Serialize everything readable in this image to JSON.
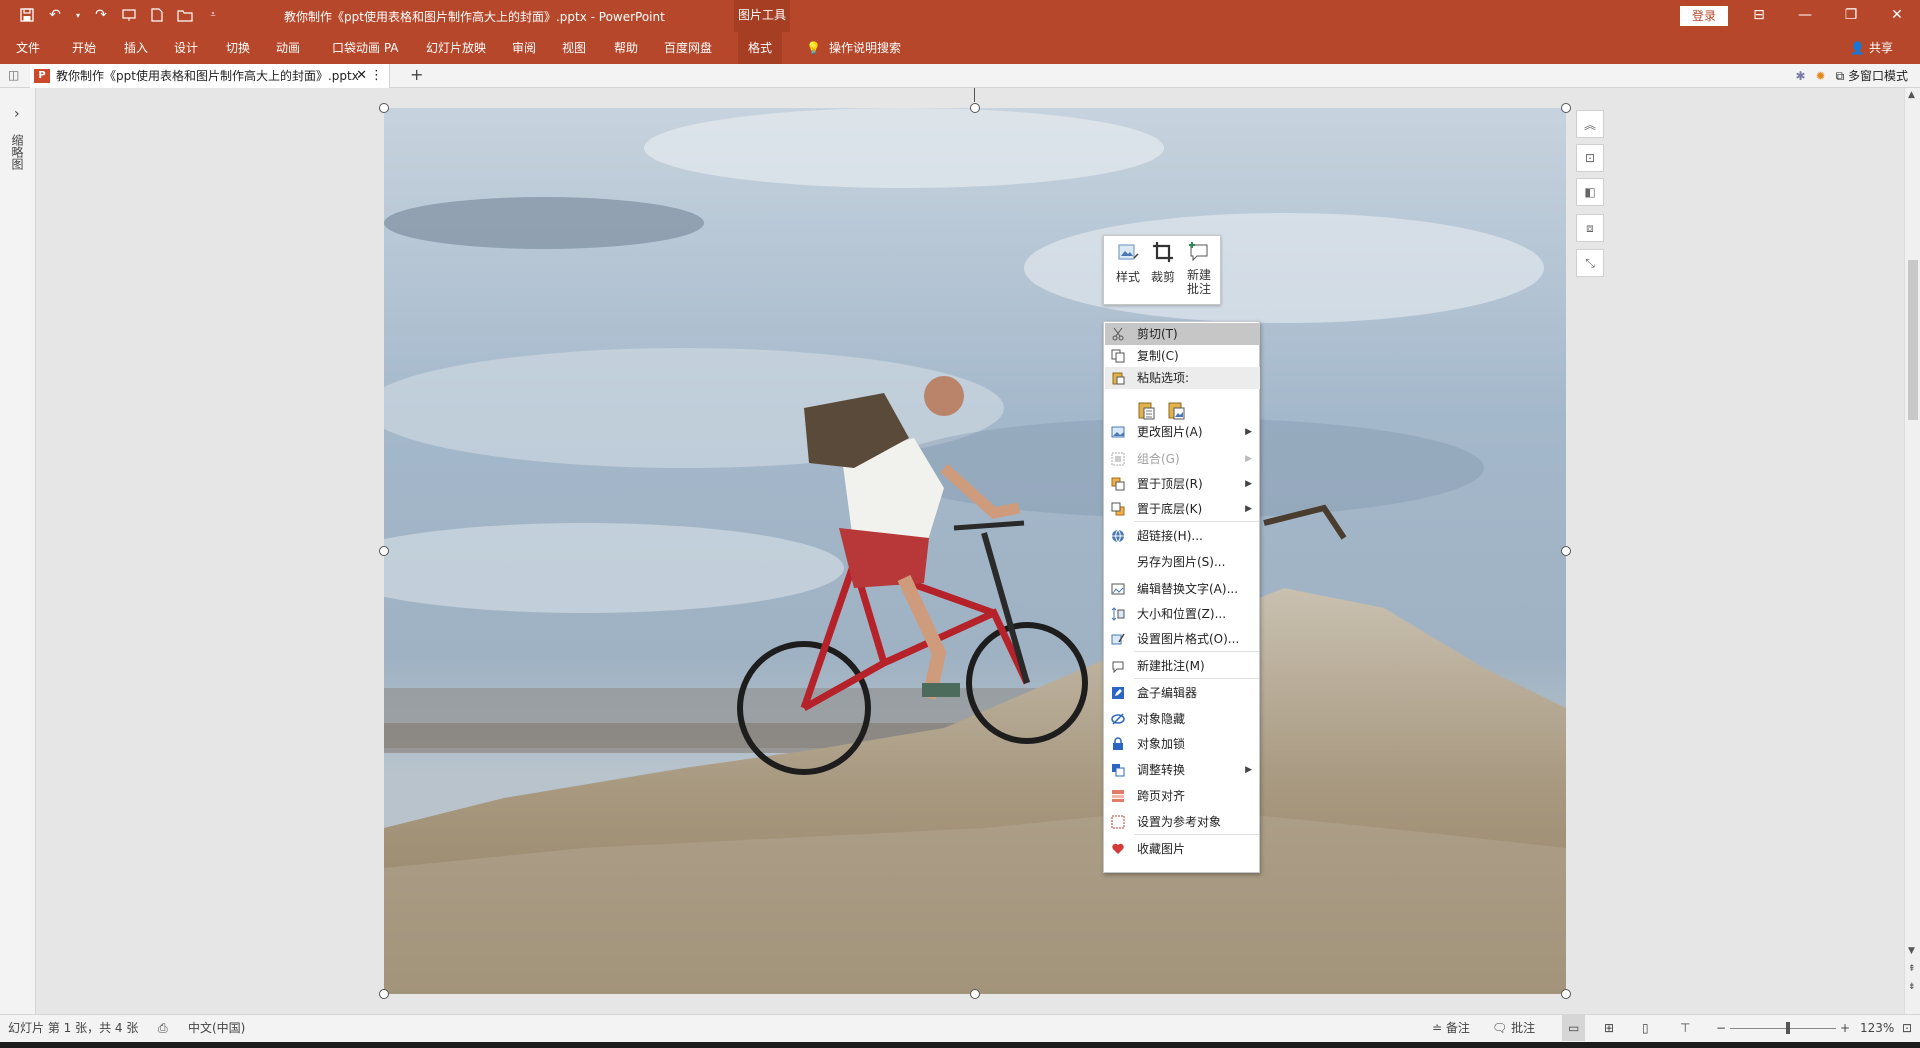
{
  "titlebar": {
    "title": "教你制作《ppt使用表格和图片制作高大上的封面》.pptx  -  PowerPoint",
    "context_tab": "图片工具",
    "login_label": "登录",
    "icons": [
      "save-icon",
      "undo-icon",
      "redo-icon",
      "present-icon",
      "new-file-icon",
      "open-folder-icon",
      "customize-qat-icon"
    ]
  },
  "ribbon": {
    "tabs": [
      "文件",
      "开始",
      "插入",
      "设计",
      "切换",
      "动画",
      "口袋动画 PA",
      "幻灯片放映",
      "审阅",
      "视图",
      "帮助",
      "百度网盘",
      "格式"
    ],
    "active_tab": "格式",
    "search_label": "操作说明搜索",
    "share_label": "共享"
  },
  "tabstrip": {
    "doc_tab_label": "教你制作《ppt使用表格和图片制作高大上的封面》.pptx",
    "multi_window_label": "多窗口模式"
  },
  "leftpanel": {
    "label": "缩略图"
  },
  "minitoolbar": {
    "style_label": "样式",
    "crop_label": "裁剪",
    "new_comment_label": "新建\n批注"
  },
  "contextmenu": {
    "items": [
      {
        "label": "剪切(T)",
        "icon": "scissors-icon",
        "submenu": false,
        "disabled": false
      },
      {
        "label": "复制(C)",
        "icon": "copy-icon",
        "submenu": false,
        "disabled": false
      },
      {
        "label": "粘贴选项:",
        "icon": "paste-icon",
        "submenu": false,
        "disabled": false
      },
      {
        "label": "更改图片(A)",
        "icon": "change-picture-icon",
        "submenu": true,
        "disabled": false
      },
      {
        "label": "组合(G)",
        "icon": "group-icon",
        "submenu": true,
        "disabled": true
      },
      {
        "label": "置于顶层(R)",
        "icon": "bring-front-icon",
        "submenu": true,
        "disabled": false
      },
      {
        "label": "置于底层(K)",
        "icon": "send-back-icon",
        "submenu": true,
        "disabled": false
      },
      {
        "label": "超链接(H)...",
        "icon": "hyperlink-icon",
        "submenu": false,
        "disabled": false
      },
      {
        "label": "另存为图片(S)...",
        "icon": "",
        "submenu": false,
        "disabled": false
      },
      {
        "label": "编辑替换文字(A)...",
        "icon": "alt-text-icon",
        "submenu": false,
        "disabled": false
      },
      {
        "label": "大小和位置(Z)...",
        "icon": "size-position-icon",
        "submenu": false,
        "disabled": false
      },
      {
        "label": "设置图片格式(O)...",
        "icon": "format-picture-icon",
        "submenu": false,
        "disabled": false
      },
      {
        "label": "新建批注(M)",
        "icon": "comment-icon",
        "submenu": false,
        "disabled": false
      },
      {
        "label": "盒子编辑器",
        "icon": "box-editor-icon",
        "submenu": false,
        "disabled": false
      },
      {
        "label": "对象隐藏",
        "icon": "hide-icon",
        "submenu": false,
        "disabled": false
      },
      {
        "label": "对象加锁",
        "icon": "lock-icon",
        "submenu": false,
        "disabled": false
      },
      {
        "label": "调整转换",
        "icon": "convert-icon",
        "submenu": true,
        "disabled": false
      },
      {
        "label": "跨页对齐",
        "icon": "align-pages-icon",
        "submenu": false,
        "disabled": false
      },
      {
        "label": "设置为参考对象",
        "icon": "reference-icon",
        "submenu": false,
        "disabled": false
      },
      {
        "label": "收藏图片",
        "icon": "favorite-icon",
        "submenu": false,
        "disabled": false
      }
    ]
  },
  "statusbar": {
    "slide_info": "幻灯片 第 1 张，共 4 张",
    "language": "中文(中国)",
    "notes_label": "备注",
    "comments_label": "批注",
    "zoom_level": "123%",
    "zoom_fraction": 0.55
  },
  "colors": {
    "accent": "#b7472a",
    "accent_dark": "#a63e24",
    "highlight": "#c6c6c6"
  }
}
